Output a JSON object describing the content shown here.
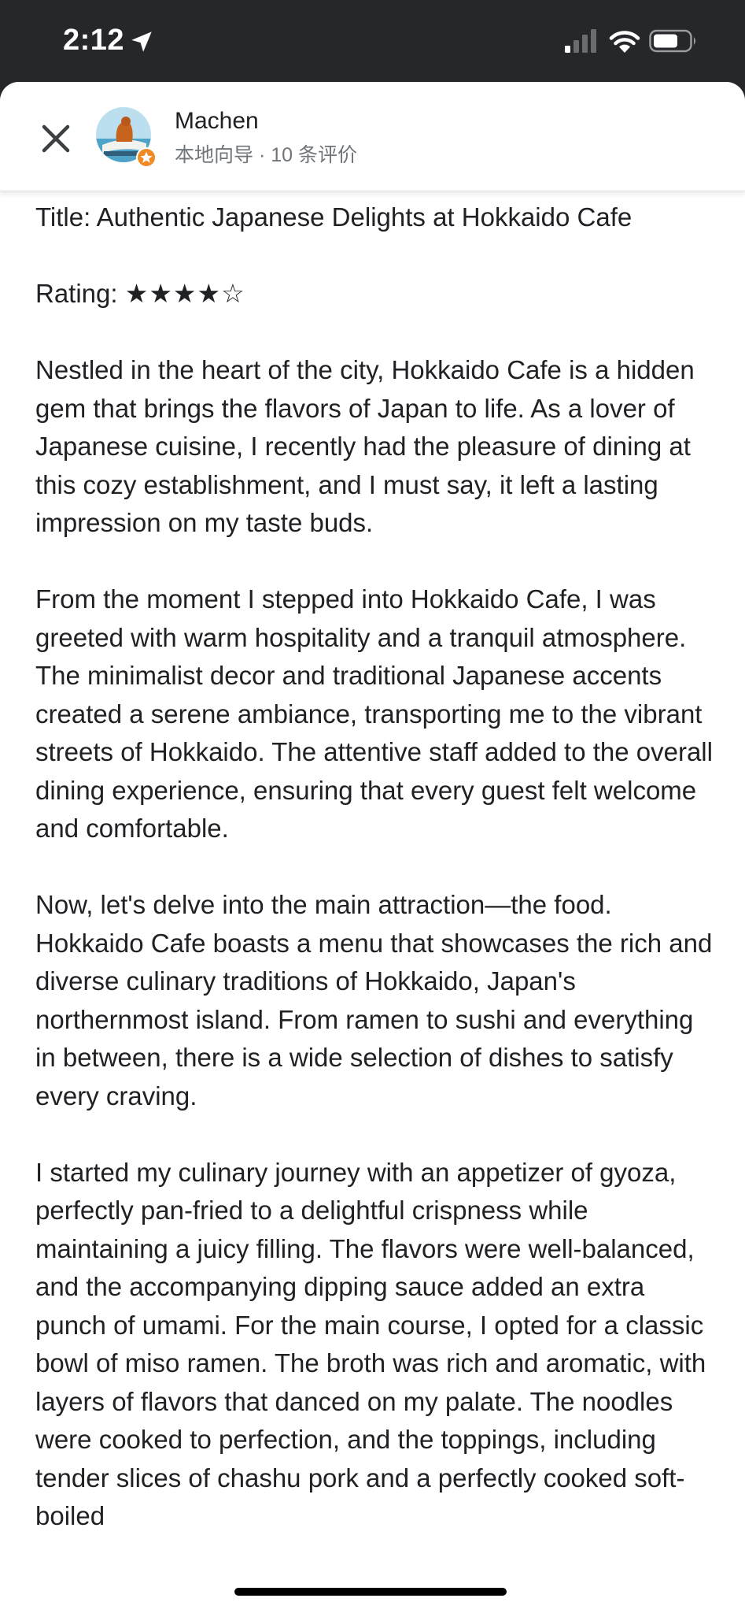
{
  "status_bar": {
    "time": "2:12"
  },
  "header": {
    "reviewer_name": "Machen",
    "reviewer_meta": "本地向导 · 10 条评价"
  },
  "review": {
    "title_line": "Title: Authentic Japanese Delights at Hokkaido Cafe",
    "rating_label": "Rating:",
    "rating_stars": "★★★★☆",
    "rating_value": 4,
    "rating_max": 5,
    "paragraphs": [
      "Nestled in the heart of the city, Hokkaido Cafe is a hidden gem that brings the flavors of Japan to life. As a lover of Japanese cuisine, I recently had the pleasure of dining at this cozy establishment, and I must say, it left a lasting impression on my taste buds.",
      "From the moment I stepped into Hokkaido Cafe, I was greeted with warm hospitality and a tranquil atmosphere. The minimalist decor and traditional Japanese accents created a serene ambiance, transporting me to the vibrant streets of Hokkaido. The attentive staff added to the overall dining experience, ensuring that every guest felt welcome and comfortable.",
      "Now, let's delve into the main attraction—the food. Hokkaido Cafe boasts a menu that showcases the rich and diverse culinary traditions of Hokkaido, Japan's northernmost island. From ramen to sushi and everything in between, there is a wide selection of dishes to satisfy every craving.",
      "I started my culinary journey with an appetizer of gyoza, perfectly pan-fried to a delightful crispness while maintaining a juicy filling. The flavors were well-balanced, and the accompanying dipping sauce added an extra punch of umami. For the main course, I opted for a classic bowl of miso ramen. The broth was rich and aromatic, with layers of flavors that danced on my palate. The noodles were cooked to perfection, and the toppings, including tender slices of chashu pork and a perfectly cooked soft-boiled"
    ]
  },
  "colors": {
    "status_bar_bg": "#26272b",
    "sheet_bg": "#ffffff",
    "text_primary": "#202124",
    "text_secondary": "#70757a",
    "local_guide_badge": "#f08a24"
  },
  "icons": {
    "location": "location-arrow-icon",
    "signal": "cellular-signal-icon",
    "wifi": "wifi-icon",
    "battery": "battery-icon",
    "close": "close-icon",
    "badge": "local-guide-star-icon"
  }
}
